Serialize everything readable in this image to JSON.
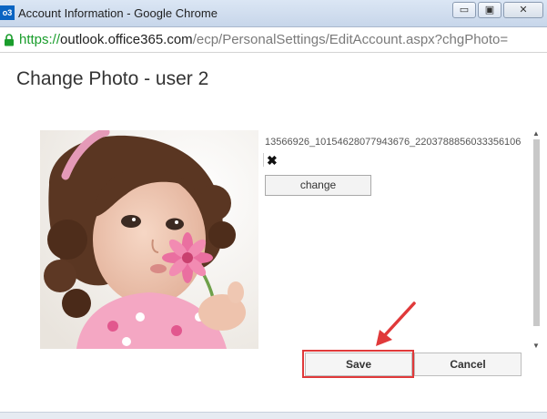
{
  "window": {
    "app_icon_text": "o3",
    "title": "Account Information - Google Chrome",
    "minimize": "▭",
    "maximize": "▣",
    "close": "✕"
  },
  "address_bar": {
    "scheme": "https://",
    "host": "outlook.office365.com",
    "path": "/ecp/PersonalSettings/EditAccount.aspx?chgPhoto="
  },
  "dialog": {
    "title": "Change Photo - user 2",
    "filename": "13566926_10154628077943676_2203788856033356106",
    "remove_icon": "✖",
    "change_label": "change",
    "save_label": "Save",
    "cancel_label": "Cancel"
  },
  "colors": {
    "highlight": "#e0393a",
    "secure_green": "#1a9d2c"
  }
}
